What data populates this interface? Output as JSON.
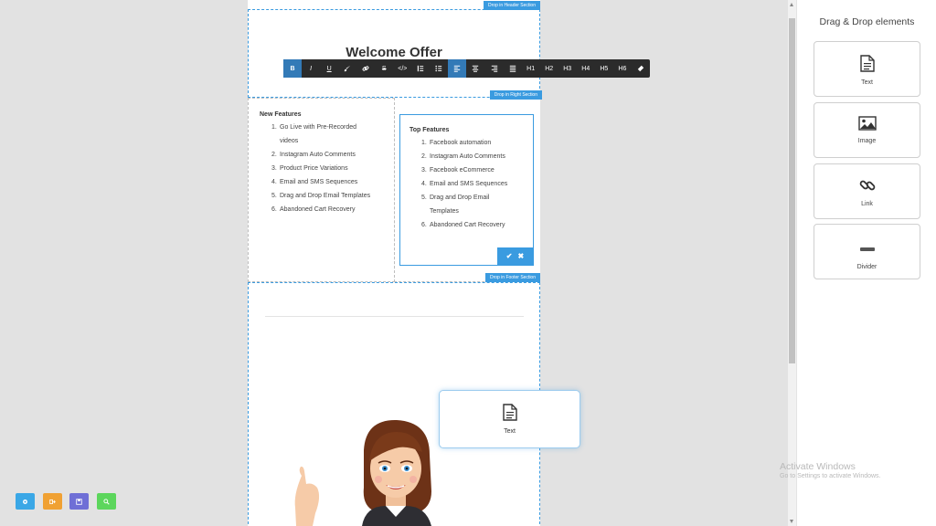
{
  "header_section": {
    "tag": "Drop in Header Section",
    "title": "Welcome Offer"
  },
  "right_section_tag": "Drop in Right Section",
  "footer_section_tag": "Drop in Footer Section",
  "toolbar": [
    {
      "label": "B",
      "icon": "bold-icon"
    },
    {
      "label": "I",
      "icon": "italic-icon"
    },
    {
      "label": "U",
      "icon": "underline-icon"
    },
    {
      "label": "",
      "icon": "brush-icon"
    },
    {
      "label": "",
      "icon": "link-icon"
    },
    {
      "label": "S",
      "icon": "strikethrough-icon"
    },
    {
      "label": "</>",
      "icon": "code-icon"
    },
    {
      "label": "",
      "icon": "ordered-list-icon"
    },
    {
      "label": "",
      "icon": "unordered-list-icon"
    },
    {
      "label": "",
      "icon": "align-left-icon"
    },
    {
      "label": "",
      "icon": "align-center-icon"
    },
    {
      "label": "",
      "icon": "align-right-icon"
    },
    {
      "label": "",
      "icon": "align-justify-icon"
    },
    {
      "label": "H1",
      "icon": "heading-1-icon"
    },
    {
      "label": "H2",
      "icon": "heading-2-icon"
    },
    {
      "label": "H3",
      "icon": "heading-3-icon"
    },
    {
      "label": "H4",
      "icon": "heading-4-icon"
    },
    {
      "label": "H5",
      "icon": "heading-5-icon"
    },
    {
      "label": "H6",
      "icon": "heading-6-icon"
    },
    {
      "label": "",
      "icon": "eraser-icon"
    }
  ],
  "left_column": {
    "title": "New Features",
    "items": [
      {
        "num": "1.",
        "line1": "Go Live with Pre-Recorded",
        "line2": "videos"
      },
      {
        "num": "2.",
        "line1": "Instagram Auto Comments",
        "line2": ""
      },
      {
        "num": "3.",
        "line1": "Product Price Variations",
        "line2": ""
      },
      {
        "num": "4.",
        "line1": "Email and SMS Sequences",
        "line2": ""
      },
      {
        "num": "5.",
        "line1": "Drag and Drop Email Templates",
        "line2": ""
      },
      {
        "num": "6.",
        "line1": "Abandoned Cart Recovery",
        "line2": ""
      }
    ]
  },
  "right_column": {
    "title": "Top Features",
    "items": [
      {
        "num": "1.",
        "line1": "Facebook automation",
        "line2": ""
      },
      {
        "num": "2.",
        "line1": "Instagram Auto Comments",
        "line2": ""
      },
      {
        "num": "3.",
        "line1": "Facebook eCommerce",
        "line2": ""
      },
      {
        "num": "4.",
        "line1": "Email and SMS Sequences",
        "line2": ""
      },
      {
        "num": "5.",
        "line1": "Drag and Drop Email",
        "line2": "Templates"
      },
      {
        "num": "6.",
        "line1": "Abandoned Cart Recovery",
        "line2": ""
      }
    ],
    "confirm_icon": "check-icon",
    "cancel_icon": "close-icon"
  },
  "drag_card": {
    "label": "Text",
    "icon": "document-icon"
  },
  "panel": {
    "title": "Drag & Drop elements",
    "elements": [
      {
        "label": "Text",
        "icon": "document-icon"
      },
      {
        "label": "Image",
        "icon": "image-icon"
      },
      {
        "label": "Link",
        "icon": "link-icon"
      },
      {
        "label": "Divider",
        "icon": "divider-icon"
      }
    ]
  },
  "action_buttons": [
    {
      "icon": "settings-icon",
      "color": "#3aa7e6"
    },
    {
      "icon": "export-icon",
      "color": "#f0a133"
    },
    {
      "icon": "save-icon",
      "color": "#6f6fd6"
    },
    {
      "icon": "preview-icon",
      "color": "#5cd65c"
    }
  ],
  "watermark": {
    "title": "Activate Windows",
    "subtitle": "Go to Settings to activate Windows."
  },
  "colors": {
    "accent": "#3a9be0",
    "toolbar_bg": "#2b2b2b",
    "toolbar_active": "#337ab7"
  }
}
